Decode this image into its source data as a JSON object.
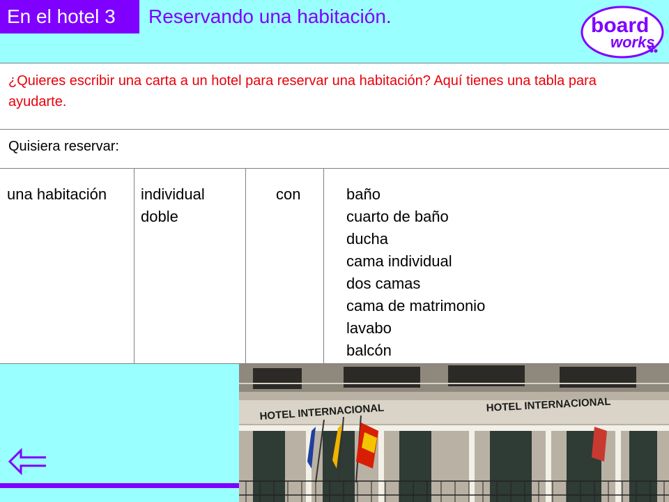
{
  "header": {
    "section_label": "En el hotel 3",
    "title": "Reservando una habitación."
  },
  "logo": {
    "line1": "board",
    "line2": "works"
  },
  "intro": {
    "text": "¿Quieres escribir una carta a un hotel para reservar una habitación? Aquí tienes una tabla para ayudarte."
  },
  "table": {
    "header": "Quisiera reservar:",
    "col1": "una habitación",
    "col2": [
      "individual",
      "doble"
    ],
    "col3": "con",
    "col4": [
      "baño",
      "cuarto de baño",
      "ducha",
      "cama individual",
      "dos camas",
      "cama de matrimonio",
      "lavabo",
      "balcón"
    ]
  },
  "photo": {
    "sign1": "HOTEL INTERNACIONAL",
    "sign2": "HOTEL INTERNACIONAL"
  },
  "colors": {
    "background": "#99ffff",
    "accent": "#7f00ff",
    "intro_text": "#e8000b"
  },
  "nav": {
    "back_icon": "back-arrow-icon"
  }
}
